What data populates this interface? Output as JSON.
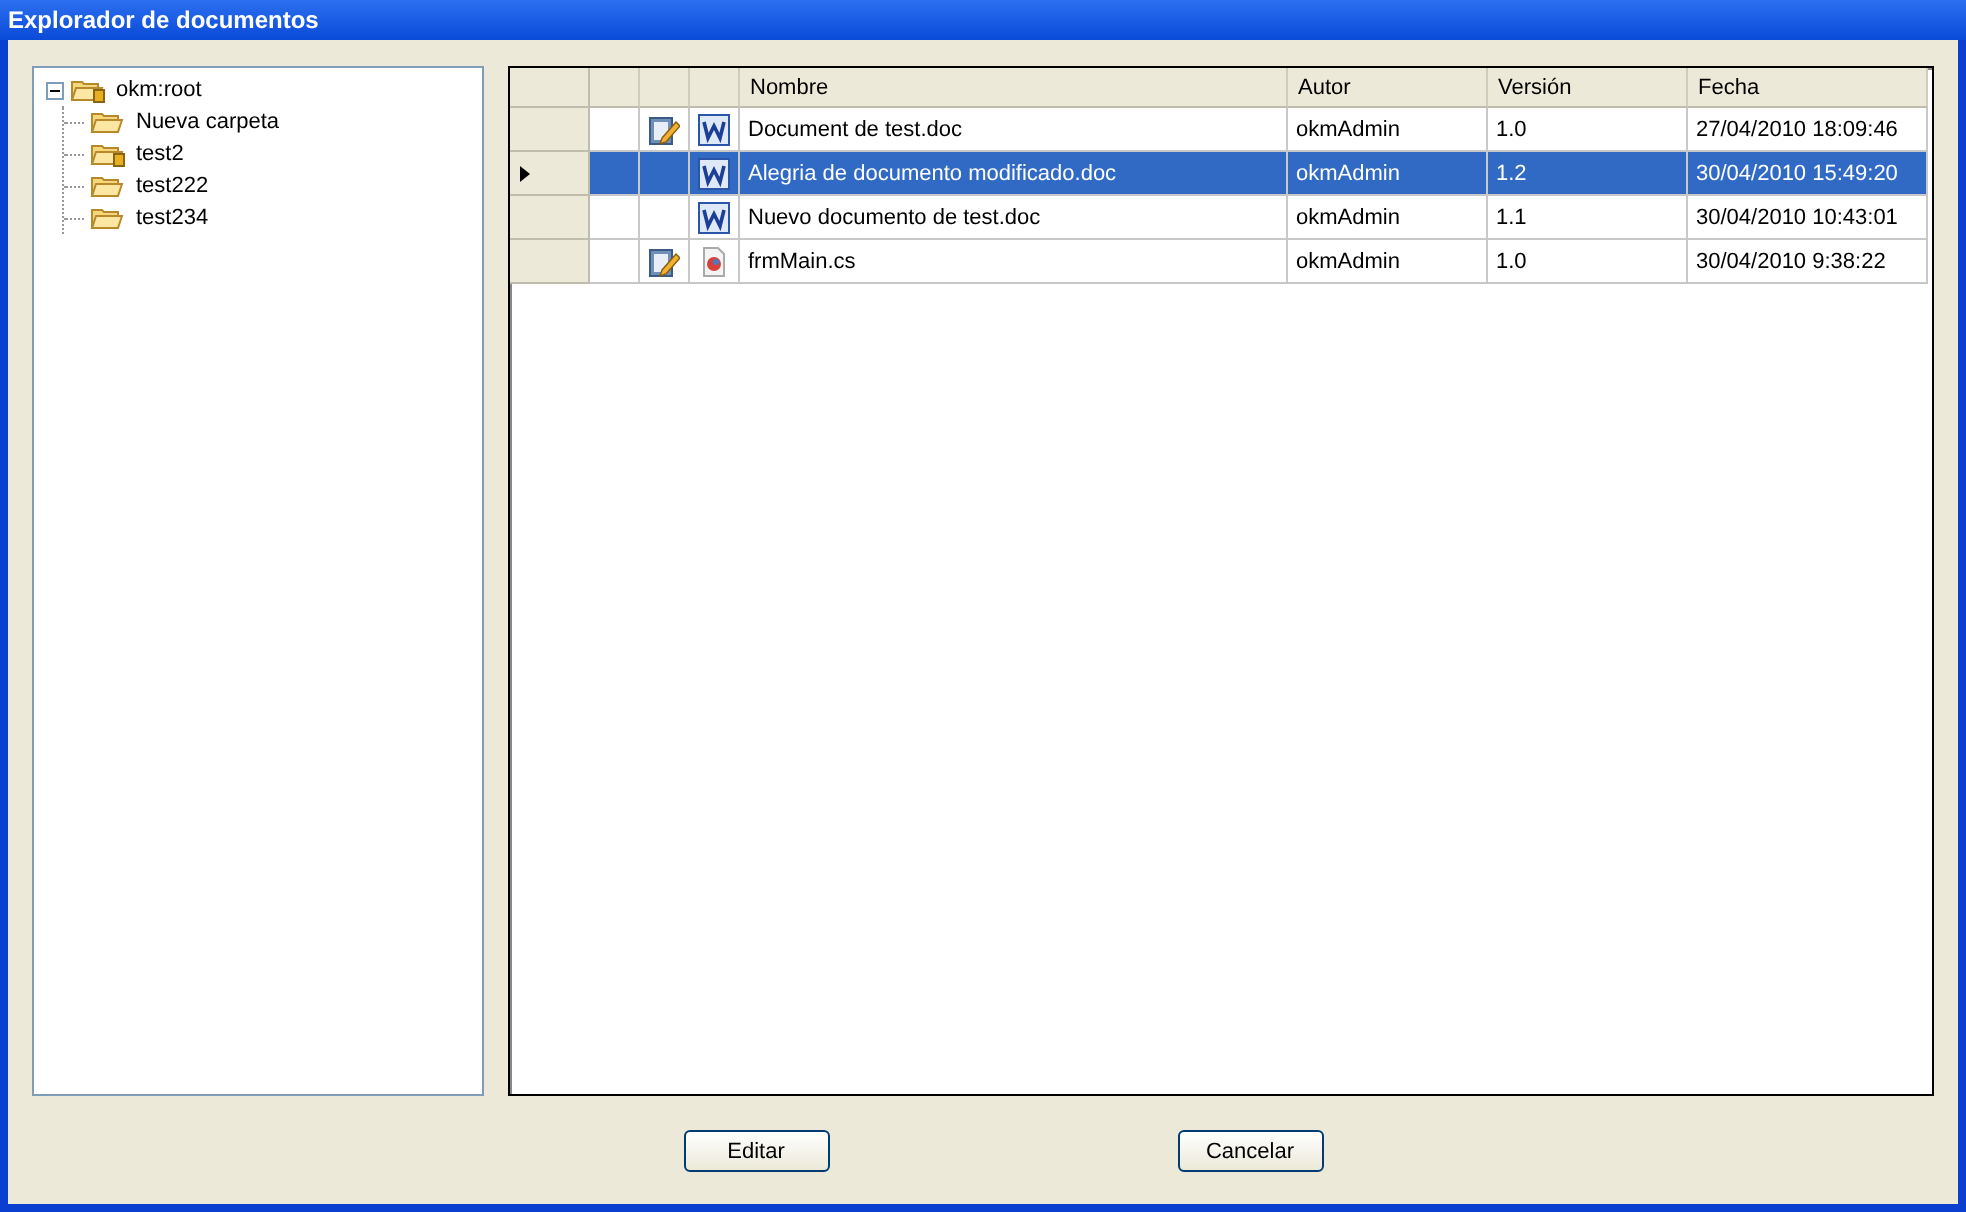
{
  "window": {
    "title": "Explorador de documentos"
  },
  "tree": {
    "label": "okm:root",
    "expanded": true,
    "locked": true,
    "children": [
      {
        "label": "Nueva carpeta",
        "locked": false
      },
      {
        "label": "test2",
        "locked": true
      },
      {
        "label": "test222",
        "locked": false
      },
      {
        "label": "test234",
        "locked": false
      }
    ]
  },
  "table": {
    "columns": [
      "Nombre",
      "Autor",
      "Versión",
      "Fecha"
    ],
    "rows": [
      {
        "selected": false,
        "checked_out": true,
        "kind": "word",
        "cells": [
          "Document de test.doc",
          "okmAdmin",
          "1.0",
          "27/04/2010 18:09:46"
        ]
      },
      {
        "selected": true,
        "checked_out": false,
        "kind": "word",
        "cells": [
          "Alegria de documento modificado.doc",
          "okmAdmin",
          "1.2",
          "30/04/2010 15:49:20"
        ]
      },
      {
        "selected": false,
        "checked_out": false,
        "kind": "word",
        "cells": [
          "Nuevo documento de test.doc",
          "okmAdmin",
          "1.1",
          "30/04/2010 10:43:01"
        ]
      },
      {
        "selected": false,
        "checked_out": true,
        "kind": "code",
        "cells": [
          "frmMain.cs",
          "okmAdmin",
          "1.0",
          "30/04/2010 9:38:22"
        ]
      }
    ]
  },
  "buttons": [
    "Editar",
    "Cancelar"
  ]
}
